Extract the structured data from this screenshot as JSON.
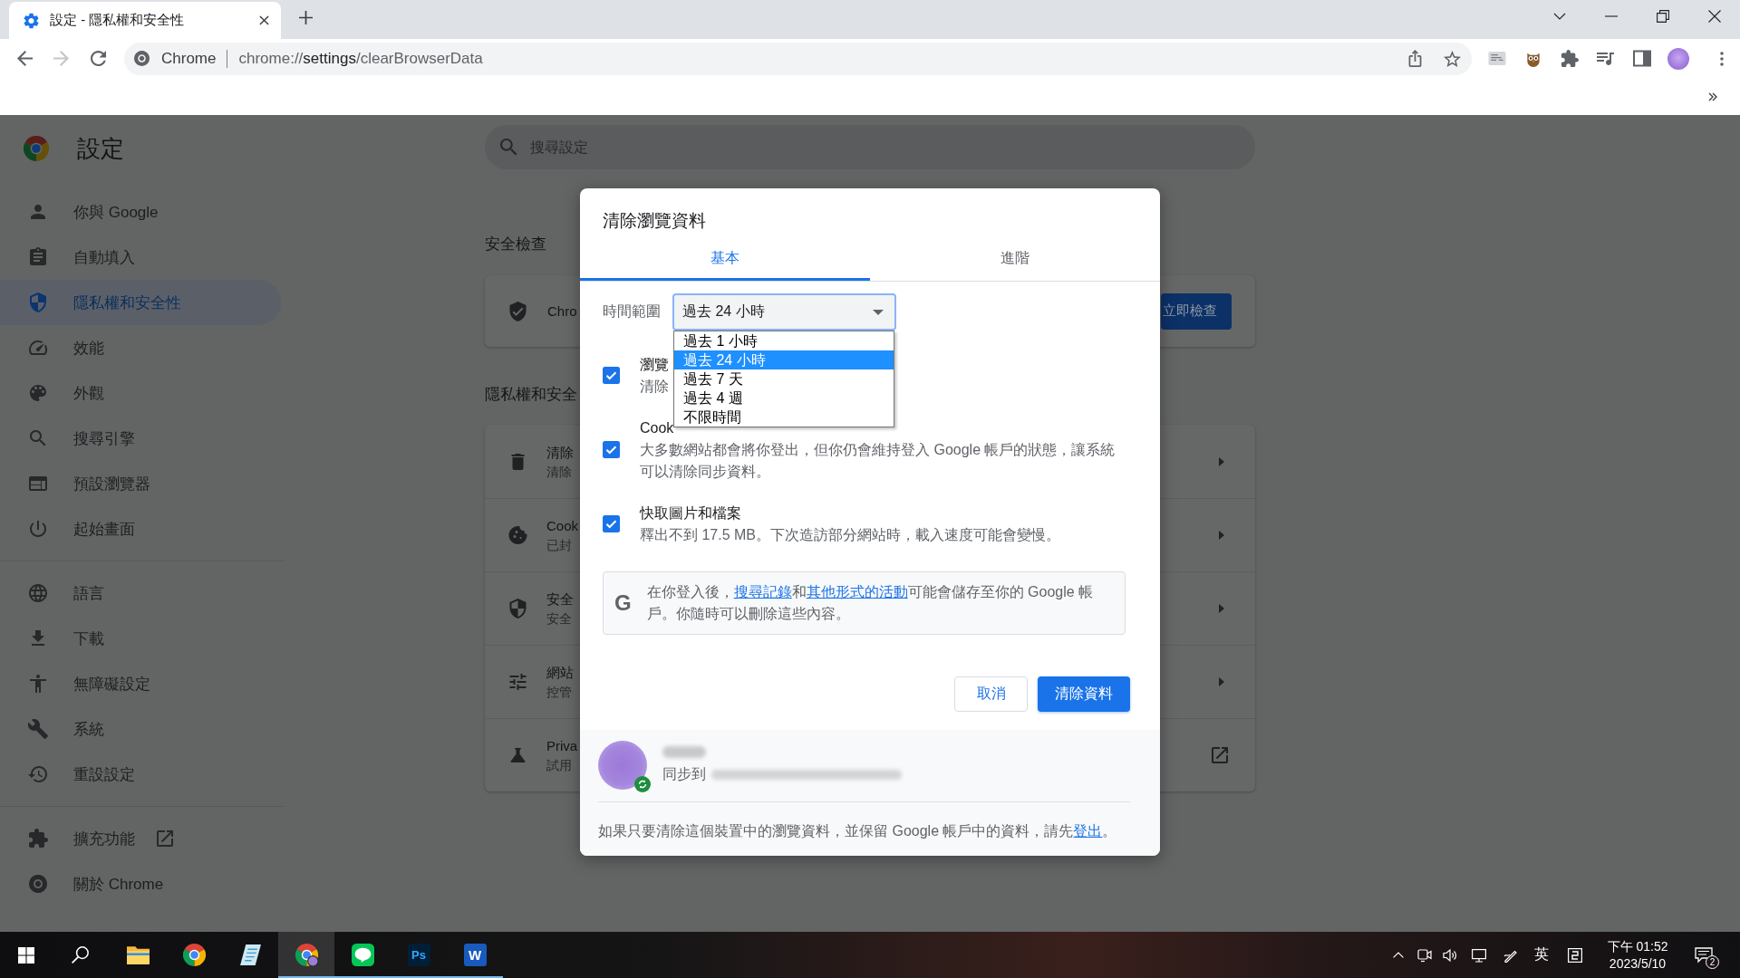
{
  "browser": {
    "tabs": [
      {
        "title": "設定 - 隱私權和安全性",
        "selected": true
      }
    ],
    "nav": {
      "back_disabled": false,
      "forward_disabled": true
    },
    "omnibox": {
      "site": "Chrome",
      "url": {
        "scheme": "chrome://",
        "host": "settings",
        "path": "/clearBrowserData"
      }
    }
  },
  "settings": {
    "title": "設定",
    "search": {
      "placeholder": "搜尋設定"
    },
    "sidebar": {
      "groups": [
        {
          "items": [
            {
              "label": "你與 Google",
              "selected": false,
              "external": false
            },
            {
              "label": "自動填入",
              "selected": false,
              "external": false
            },
            {
              "label": "隱私權和安全性",
              "selected": true,
              "external": false
            },
            {
              "label": "效能",
              "selected": false,
              "external": false
            },
            {
              "label": "外觀",
              "selected": false,
              "external": false
            },
            {
              "label": "搜尋引擎",
              "selected": false,
              "external": false
            },
            {
              "label": "預設瀏覽器",
              "selected": false,
              "external": false
            },
            {
              "label": "起始畫面",
              "selected": false,
              "external": false
            }
          ]
        },
        {
          "items": [
            {
              "label": "語言",
              "selected": false,
              "external": false
            },
            {
              "label": "下載",
              "selected": false,
              "external": false
            },
            {
              "label": "無障礙設定",
              "selected": false,
              "external": false
            },
            {
              "label": "系統",
              "selected": false,
              "external": false
            },
            {
              "label": "重設設定",
              "selected": false,
              "external": false
            }
          ]
        },
        {
          "items": [
            {
              "label": "擴充功能",
              "selected": false,
              "external": true
            },
            {
              "label": "關於 Chrome",
              "selected": false,
              "external": false
            }
          ]
        }
      ]
    },
    "safety_check": {
      "heading": "安全檢查",
      "title": "Chro",
      "button": "立即檢查"
    },
    "privacy": {
      "heading": "隱私權和安全",
      "rows": [
        {
          "title": "清除",
          "subtitle": "清除",
          "kind": "arrow"
        },
        {
          "title": "Cook",
          "subtitle": "已封",
          "kind": "arrow"
        },
        {
          "title": "安全",
          "subtitle": "安全",
          "kind": "arrow"
        },
        {
          "title": "網站",
          "subtitle": "控管",
          "kind": "arrow"
        },
        {
          "title": "Priva",
          "subtitle": "試用",
          "kind": "external"
        }
      ]
    }
  },
  "dialog": {
    "title": "清除瀏覽資料",
    "tabs": [
      {
        "label": "基本",
        "selected": true
      },
      {
        "label": "進階",
        "selected": false
      }
    ],
    "time_range": {
      "label": "時間範圍",
      "value": "過去 24 小時",
      "expanded": true,
      "options": [
        {
          "label": "過去 1 小時",
          "selected": false
        },
        {
          "label": "過去 24 小時",
          "selected": true
        },
        {
          "label": "過去 7 天",
          "selected": false
        },
        {
          "label": "過去 4 週",
          "selected": false
        },
        {
          "label": "不限時間",
          "selected": false
        }
      ]
    },
    "options": [
      {
        "title": "瀏覽",
        "description": "清除",
        "checked": true
      },
      {
        "title": "Cook",
        "description": "大多數網站都會將你登出，但你仍會維持登入 Google 帳戶的狀態，讓系統可以清除同步資料。",
        "checked": true
      },
      {
        "title": "快取圖片和檔案",
        "description": "釋出不到 17.5 MB。下次造訪部分網站時，載入速度可能會變慢。",
        "checked": true
      }
    ],
    "info": {
      "logo": "G",
      "parts": [
        {
          "text": "在你登入後，",
          "link": false
        },
        {
          "text": "搜尋記錄",
          "link": true
        },
        {
          "text": "和",
          "link": false
        },
        {
          "text": "其他形式的活動",
          "link": true
        },
        {
          "text": "可能會儲存至你的 Google 帳戶。你隨時可以刪除這些內容。",
          "link": false
        }
      ]
    },
    "buttons": [
      {
        "label": "取消",
        "kind": "secondary"
      },
      {
        "label": "清除資料",
        "kind": "primary"
      }
    ],
    "account": {
      "sync_label": "同步到"
    },
    "footer": {
      "parts": [
        {
          "text": "如果只要清除這個裝置中的瀏覽資料，並保留 Google 帳戶中的資料，請先",
          "link": false
        },
        {
          "text": "登出",
          "link": true
        },
        {
          "text": "。",
          "link": false
        }
      ]
    }
  },
  "taskbar": {
    "apps": [
      {
        "kind": "folder",
        "selected": false,
        "running": false
      },
      {
        "kind": "browser",
        "selected": false,
        "running": false
      },
      {
        "kind": "notes",
        "selected": false,
        "running": false
      },
      {
        "kind": "profile",
        "selected": true,
        "running": true
      },
      {
        "kind": "chat",
        "selected": false,
        "running": true
      },
      {
        "kind": "ps",
        "label": "Ps",
        "selected": false,
        "running": true
      },
      {
        "kind": "word",
        "label": "W",
        "selected": false,
        "running": true
      }
    ],
    "tray": {
      "ime": "英",
      "time": "下午 01:52",
      "date": "2023/5/10",
      "notifications": "2"
    }
  }
}
